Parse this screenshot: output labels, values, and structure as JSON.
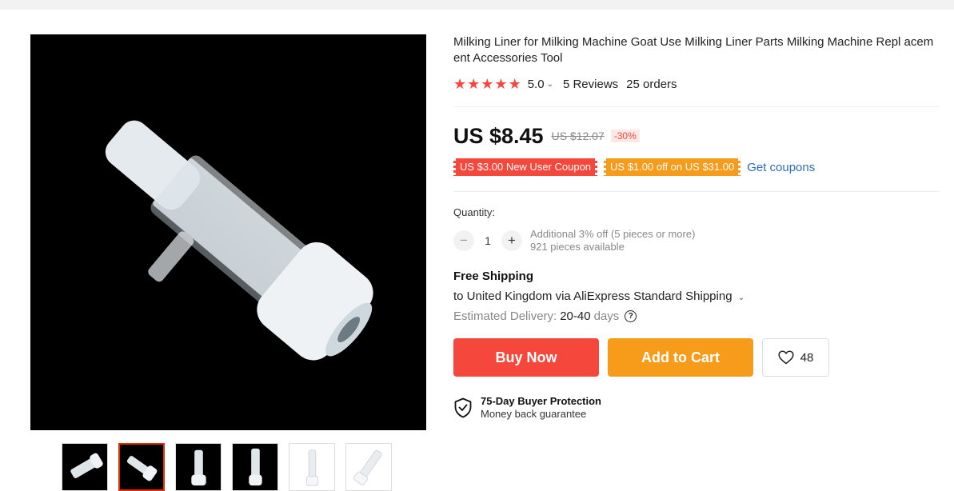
{
  "product": {
    "title": "Milking Liner for Milking Machine Goat Use Milking Liner Parts Milking Machine Repl acement Accessories Tool",
    "rating": "5.0",
    "reviews": "5 Reviews",
    "orders": "25 orders",
    "price": "US $8.45",
    "original_price": "US $12.07",
    "discount": "-30%"
  },
  "coupons": {
    "new_user": "US $3.00 New User Coupon",
    "store": "US $1.00 off on US $31.00",
    "get_label": "Get coupons"
  },
  "quantity": {
    "label": "Quantity:",
    "value": "1",
    "minus": "−",
    "plus": "+",
    "additional": "Additional 3% off (5 pieces or more)",
    "available": "921 pieces available"
  },
  "shipping": {
    "title": "Free Shipping",
    "to": "to United Kingdom via AliExpress Standard Shipping",
    "estimated_label": "Estimated Delivery:",
    "days": "20-40",
    "days_unit": "days"
  },
  "actions": {
    "buy_now": "Buy Now",
    "add_to_cart": "Add to Cart",
    "wishlist_count": "48"
  },
  "protection": {
    "title": "75-Day Buyer Protection",
    "subtitle": "Money back guarantee"
  },
  "colors": {
    "accent_red": "#f5473b",
    "accent_orange": "#f79b1b",
    "link_blue": "#2e6ac2"
  },
  "icons": {
    "rating_star": "star-icon",
    "wishlist": "heart-icon",
    "help": "question-icon",
    "protection": "shield-check-icon"
  }
}
